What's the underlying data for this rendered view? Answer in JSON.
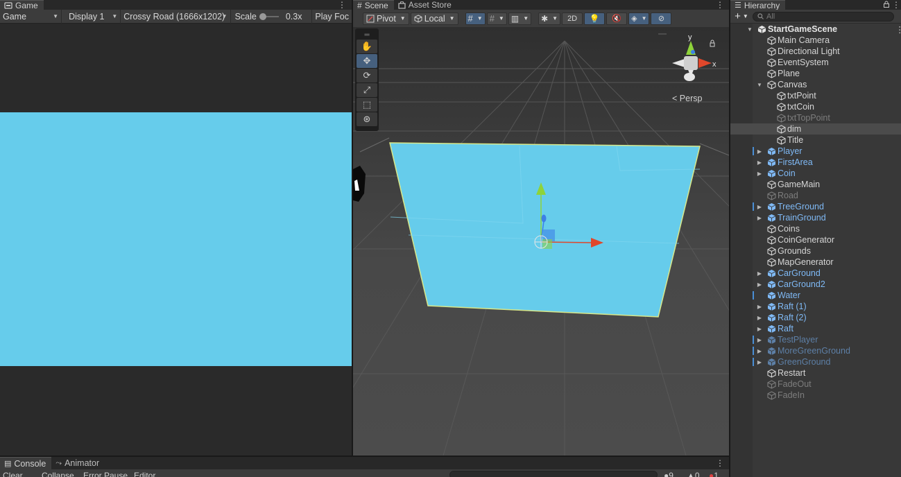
{
  "game": {
    "tab_label": "Game",
    "view_mode": "Game",
    "display": "Display 1",
    "resolution": "Crossy Road (1666x1202)",
    "scale_label": "Scale",
    "scale_value": "0.3x",
    "play_focused": "Play Foc"
  },
  "scene": {
    "tab_label": "Scene",
    "asset_store_label": "Asset Store",
    "pivot": "Pivot",
    "local": "Local",
    "mode_2d": "2D",
    "persp_label": "Persp",
    "gizmo_y": "y",
    "gizmo_x": "x"
  },
  "hierarchy": {
    "tab_label": "Hierarchy",
    "search_placeholder": "All",
    "items": [
      {
        "label": "StartGameScene",
        "indent": 0,
        "type": "scene",
        "expanded": true
      },
      {
        "label": "Main Camera",
        "indent": 1,
        "type": "object"
      },
      {
        "label": "Directional Light",
        "indent": 1,
        "type": "object"
      },
      {
        "label": "EventSystem",
        "indent": 1,
        "type": "object"
      },
      {
        "label": "Plane",
        "indent": 1,
        "type": "object"
      },
      {
        "label": "Canvas",
        "indent": 1,
        "type": "object",
        "expanded": true
      },
      {
        "label": "txtPoint",
        "indent": 2,
        "type": "object"
      },
      {
        "label": "txtCoin",
        "indent": 2,
        "type": "object"
      },
      {
        "label": "txtTopPoint",
        "indent": 2,
        "type": "object",
        "disabled": true
      },
      {
        "label": "dim",
        "indent": 2,
        "type": "object",
        "selected": true
      },
      {
        "label": "Title",
        "indent": 2,
        "type": "object"
      },
      {
        "label": "Player",
        "indent": 1,
        "type": "prefab",
        "collapsed": true,
        "mark": true
      },
      {
        "label": "FirstArea",
        "indent": 1,
        "type": "prefab",
        "collapsed": true
      },
      {
        "label": "Coin",
        "indent": 1,
        "type": "prefab",
        "collapsed": true
      },
      {
        "label": "GameMain",
        "indent": 1,
        "type": "object"
      },
      {
        "label": "Road",
        "indent": 1,
        "type": "object",
        "disabled": true
      },
      {
        "label": "TreeGround",
        "indent": 1,
        "type": "prefab",
        "collapsed": true,
        "mark": true
      },
      {
        "label": "TrainGround",
        "indent": 1,
        "type": "prefab",
        "collapsed": true
      },
      {
        "label": "Coins",
        "indent": 1,
        "type": "object"
      },
      {
        "label": "CoinGenerator",
        "indent": 1,
        "type": "object"
      },
      {
        "label": "Grounds",
        "indent": 1,
        "type": "object"
      },
      {
        "label": "MapGenerator",
        "indent": 1,
        "type": "object"
      },
      {
        "label": "CarGround",
        "indent": 1,
        "type": "prefab",
        "collapsed": true
      },
      {
        "label": "CarGround2",
        "indent": 1,
        "type": "prefab",
        "collapsed": true
      },
      {
        "label": "Water",
        "indent": 1,
        "type": "prefab",
        "mark": true
      },
      {
        "label": "Raft (1)",
        "indent": 1,
        "type": "prefab",
        "collapsed": true
      },
      {
        "label": "Raft (2)",
        "indent": 1,
        "type": "prefab",
        "collapsed": true
      },
      {
        "label": "Raft",
        "indent": 1,
        "type": "prefab",
        "collapsed": true
      },
      {
        "label": "TestPlayer",
        "indent": 1,
        "type": "prefab",
        "collapsed": true,
        "disabled": true,
        "mark": true
      },
      {
        "label": "MoreGreenGround",
        "indent": 1,
        "type": "prefab",
        "collapsed": true,
        "disabled": true,
        "mark": true
      },
      {
        "label": "GreenGround",
        "indent": 1,
        "type": "prefab",
        "collapsed": true,
        "disabled": true,
        "mark": true
      },
      {
        "label": "Restart",
        "indent": 1,
        "type": "object"
      },
      {
        "label": "FadeOut",
        "indent": 1,
        "type": "object",
        "disabled": true
      },
      {
        "label": "FadeIn",
        "indent": 1,
        "type": "object",
        "disabled": true
      }
    ]
  },
  "console": {
    "tab_label": "Console",
    "animator_label": "Animator",
    "clear": "Clear",
    "collapse": "Collapse",
    "error_pause": "Error Pause",
    "editor": "Editor",
    "log_count": "9",
    "warn_count": "0",
    "error_count": "1"
  },
  "colors": {
    "game_background": "#66cceb",
    "plane": "#66cceb",
    "prefab_text": "#7fb9f5",
    "selection": "#46607e"
  }
}
